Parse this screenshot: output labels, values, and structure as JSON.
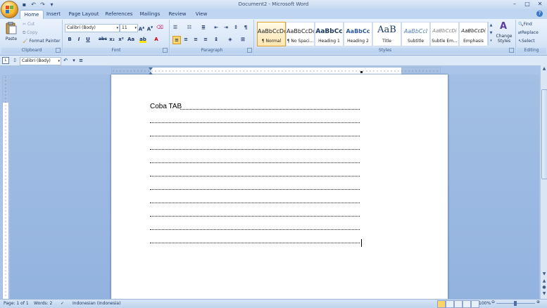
{
  "window": {
    "title": "Document2 - Microsoft Word"
  },
  "tabs": [
    "Home",
    "Insert",
    "Page Layout",
    "References",
    "Mailings",
    "Review",
    "View"
  ],
  "ribbon": {
    "clipboard": {
      "label": "Clipboard",
      "paste": "Paste",
      "cut": "Cut",
      "copy": "Copy",
      "format_painter": "Format Painter"
    },
    "font": {
      "label": "Font",
      "name": "Calibri (Body)",
      "size": "11"
    },
    "paragraph": {
      "label": "Paragraph"
    },
    "styles": {
      "label": "Styles",
      "items": [
        {
          "preview": "AaBbCcDc",
          "name": "¶ Normal"
        },
        {
          "preview": "AaBbCcDc",
          "name": "¶ No Spaci..."
        },
        {
          "preview": "AaBbCc",
          "name": "Heading 1"
        },
        {
          "preview": "AaBbCc",
          "name": "Heading 2"
        },
        {
          "preview": "AaB",
          "name": "Title"
        },
        {
          "preview": "AaBbCcI",
          "name": "Subtitle"
        },
        {
          "preview": "AaBbCcDi",
          "name": "Subtle Em..."
        },
        {
          "preview": "AaBbCcDi",
          "name": "Emphasis"
        }
      ],
      "change_styles": "Change Styles"
    },
    "editing": {
      "label": "Editing",
      "find": "Find",
      "replace": "Replace",
      "select": "Select"
    }
  },
  "mini_toolbar": {
    "font": "Calibri (Body)"
  },
  "document": {
    "first_line": "Coba TAB",
    "leader_line_count": 11
  },
  "status": {
    "page": "Page: 1 of 1",
    "words": "Words: 2",
    "language": "Indonesian (Indonesia)",
    "zoom": "100%"
  },
  "colors": {
    "accent": "#2b579a",
    "ribbon_bg": "#dbe8f8",
    "doc_bg": "#a3bfe4",
    "selected_style": "#ffe7b0"
  }
}
